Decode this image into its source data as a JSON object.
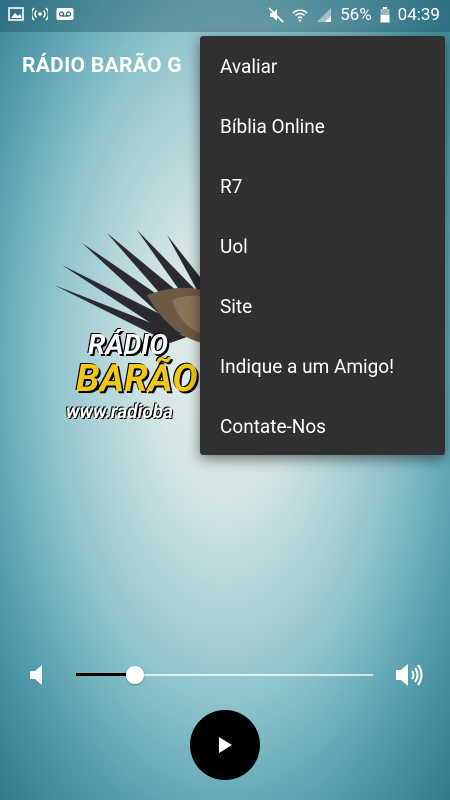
{
  "status_bar": {
    "battery": "56%",
    "time": "04:39",
    "left_icons": [
      "image-icon",
      "broadcast-icon",
      "voicemail-icon"
    ],
    "right_icons": [
      "mute-icon",
      "wifi-icon",
      "signal-icon",
      "battery-icon"
    ]
  },
  "toolbar": {
    "title": "RÁDIO BARÃO G"
  },
  "logo": {
    "line1": "RÁDIO",
    "line2": "BARÃO",
    "line3": "www.radioba"
  },
  "menu": {
    "items": [
      {
        "label": "Avaliar"
      },
      {
        "label": "Bíblia Online"
      },
      {
        "label": "R7"
      },
      {
        "label": "Uol"
      },
      {
        "label": "Site"
      },
      {
        "label": "Indique a um Amigo!"
      },
      {
        "label": "Contate-Nos"
      }
    ]
  },
  "player": {
    "volume_fraction": 0.2,
    "play_icon": "play-icon"
  },
  "colors": {
    "menu_bg": "#303030",
    "logo_yellow": "#f3c915",
    "accent": "#000000"
  }
}
